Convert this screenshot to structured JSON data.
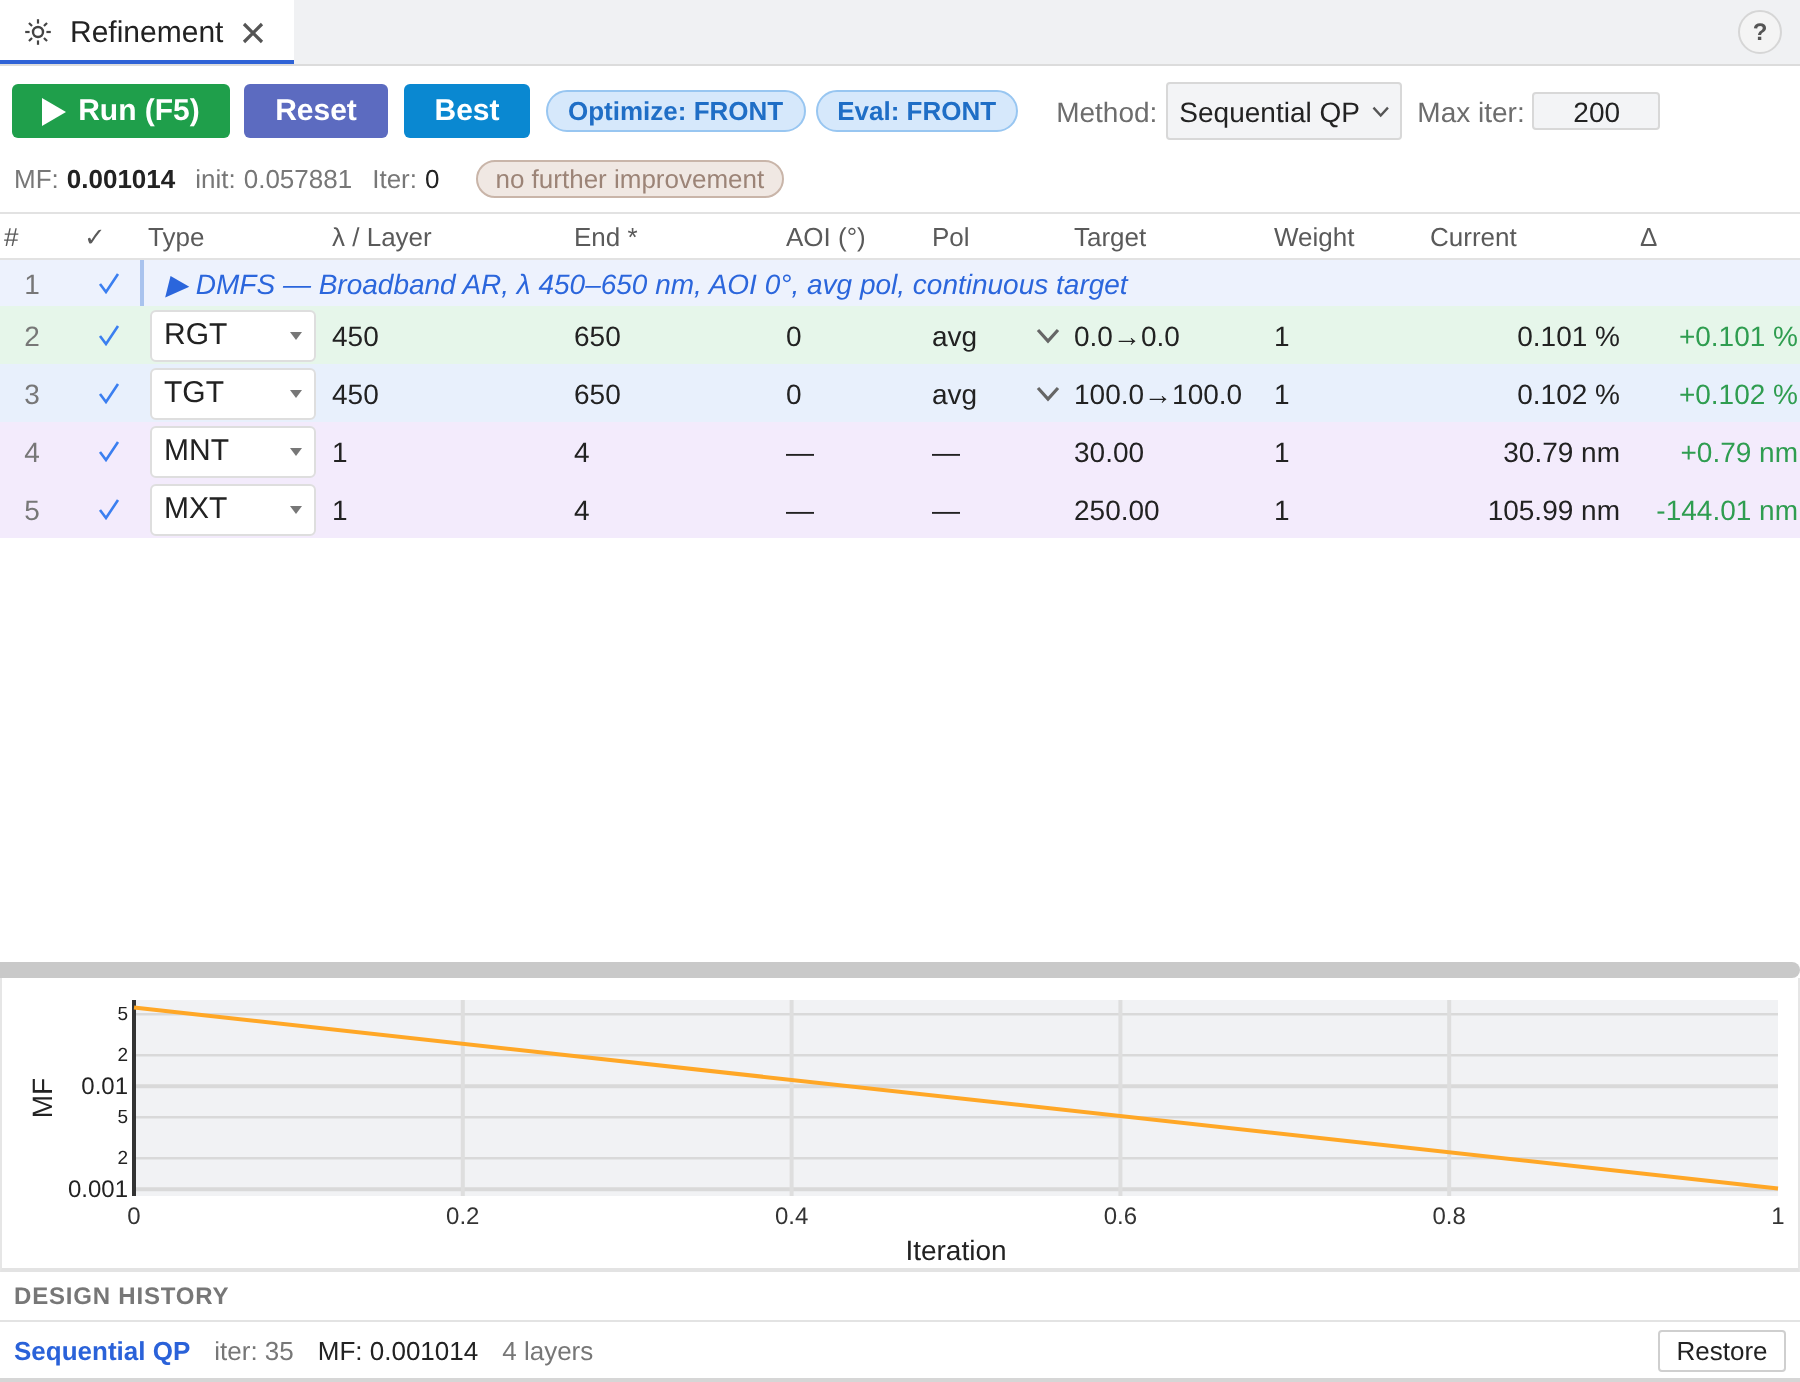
{
  "tabs": [
    {
      "label": "Refinement",
      "selected": true
    }
  ],
  "help": "?",
  "toolbar": {
    "buttons": [
      {
        "label": "Run (F5)",
        "kind": "run"
      },
      {
        "label": "Reset",
        "kind": "reset"
      },
      {
        "label": "Best",
        "kind": "best"
      }
    ],
    "pills": [
      "Optimize: FRONT",
      "Eval: FRONT"
    ],
    "method": {
      "label": "Method:",
      "value": "Sequential QP"
    },
    "max_iter": {
      "label": "Max iter:",
      "value": "200"
    }
  },
  "status": {
    "stats": [
      {
        "label": "MF:",
        "value": "0.001014",
        "kind": "primary"
      },
      {
        "label": "init:",
        "value": "0.057881",
        "kind": "muted"
      },
      {
        "label": "Iter:",
        "value": "0",
        "kind": "plain"
      }
    ],
    "badge": {
      "text": "no further improvement",
      "dimmed": true
    }
  },
  "table": {
    "columns": [
      "#",
      "✓",
      "Type",
      "λ / Layer",
      "End *",
      "AOI (°)",
      "Pol",
      "Target",
      "Weight",
      "Current",
      "Δ"
    ],
    "rows": [
      {
        "num": "1",
        "checked": true,
        "kind": "group",
        "color": "#edf2fd",
        "title": "▶ DMFS — Broadband AR, λ 450–650 nm, AOI 0°, avg pol, continuous target"
      },
      {
        "num": "2",
        "checked": true,
        "kind": "operand",
        "color": "#e6f6ea",
        "type": "RGT",
        "lambda": "450",
        "end": "650",
        "aoi": "0",
        "pol": "avg",
        "pol_menu": true,
        "target": "0.0→0.0",
        "weight": "1",
        "current": "0.101 %",
        "delta": "+0.101 %"
      },
      {
        "num": "3",
        "checked": true,
        "kind": "operand",
        "color": "#e8f0fc",
        "type": "TGT",
        "lambda": "450",
        "end": "650",
        "aoi": "0",
        "pol": "avg",
        "pol_menu": true,
        "target": "100.0→100.0",
        "weight": "1",
        "current": "0.102 %",
        "delta": "+0.102 %"
      },
      {
        "num": "4",
        "checked": true,
        "kind": "operand",
        "color": "#f3ebfc",
        "type": "MNT",
        "lambda": "1",
        "end": "4",
        "aoi": "—",
        "pol": "—",
        "pol_menu": false,
        "target": "30.00",
        "weight": "1",
        "current": "30.79 nm",
        "delta": "+0.79 nm"
      },
      {
        "num": "5",
        "checked": true,
        "kind": "operand",
        "color": "#f3ebfc",
        "type": "MXT",
        "lambda": "1",
        "end": "4",
        "aoi": "—",
        "pol": "—",
        "pol_menu": false,
        "target": "250.00",
        "weight": "1",
        "current": "105.99 nm",
        "delta": "-144.01 nm"
      }
    ]
  },
  "chart": {
    "xlabel": "Iteration",
    "ylabel": "MF",
    "xtick_labels": [
      "0",
      "0.2",
      "0.4",
      "0.6",
      "0.8",
      "1"
    ],
    "ytick_labels": [
      "5",
      "2",
      "0.01",
      "5",
      "2",
      "0.001"
    ]
  },
  "history": {
    "title": "DESIGN HISTORY",
    "entries": [
      {
        "method": "Sequential QP",
        "iter": "iter: 35",
        "mf": "MF: 0.001014",
        "layers": "4 layers",
        "action": "Restore"
      }
    ]
  }
}
